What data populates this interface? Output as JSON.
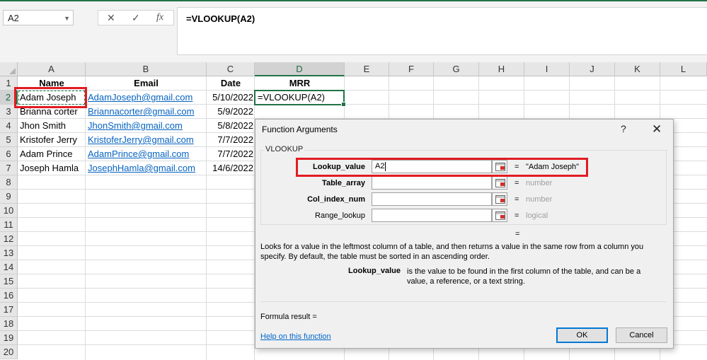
{
  "formula_bar": {
    "name_box": "A2",
    "cancel_symbol": "✕",
    "enter_symbol": "✓",
    "fx_symbol": "fx",
    "content": "=VLOOKUP(A2)"
  },
  "grid": {
    "columns": [
      "A",
      "B",
      "C",
      "D",
      "E",
      "F",
      "G",
      "H",
      "I",
      "J",
      "K",
      "L"
    ],
    "rows": [
      "1",
      "2",
      "3",
      "4",
      "5",
      "6",
      "7",
      "8",
      "9",
      "10",
      "11",
      "12",
      "13",
      "14",
      "15",
      "16",
      "17",
      "18",
      "19",
      "20"
    ],
    "header_row": {
      "a": "Name",
      "b": "Email",
      "c": "Date",
      "d": "MRR"
    },
    "data": [
      {
        "name": "Adam Joseph",
        "email": "AdamJoseph@gmail.com",
        "date": "5/10/2022",
        "mrr": "=VLOOKUP(A2)"
      },
      {
        "name": "Brianna corter",
        "email": "Briannacorter@gmail.com",
        "date": "5/9/2022"
      },
      {
        "name": "Jhon Smith",
        "email": "JhonSmith@gmail.com",
        "date": "5/8/2022"
      },
      {
        "name": "Kristofer Jerry",
        "email": "KristoferJerry@gmail.com",
        "date": "7/7/2022"
      },
      {
        "name": "Adam Prince",
        "email": "AdamPrince@gmail.com",
        "date": "7/7/2022"
      },
      {
        "name": "Joseph Hamla",
        "email": "JosephHamla@gmail.com",
        "date": "14/6/2022"
      }
    ]
  },
  "dialog": {
    "title": "Function Arguments",
    "help": "?",
    "close": "✕",
    "function_name": "VLOOKUP",
    "args": [
      {
        "label": "Lookup_value",
        "value": "A2",
        "result": "\"Adam Joseph\""
      },
      {
        "label": "Table_array",
        "value": "",
        "result": "number"
      },
      {
        "label": "Col_index_num",
        "value": "",
        "result": "number"
      },
      {
        "label": "Range_lookup",
        "value": "",
        "result": "logical"
      }
    ],
    "equals": "=",
    "description": "Looks for a value in the leftmost column of a table, and then returns a value in the same row from a column you specify. By default, the table must be sorted in an ascending order.",
    "arg_help_name": "Lookup_value",
    "arg_help_text": "is the value to be found in the first column of the table, and can be a value, a reference, or a text string.",
    "formula_result": "Formula result =",
    "help_link": "Help on this function",
    "ok": "OK",
    "cancel": "Cancel"
  }
}
